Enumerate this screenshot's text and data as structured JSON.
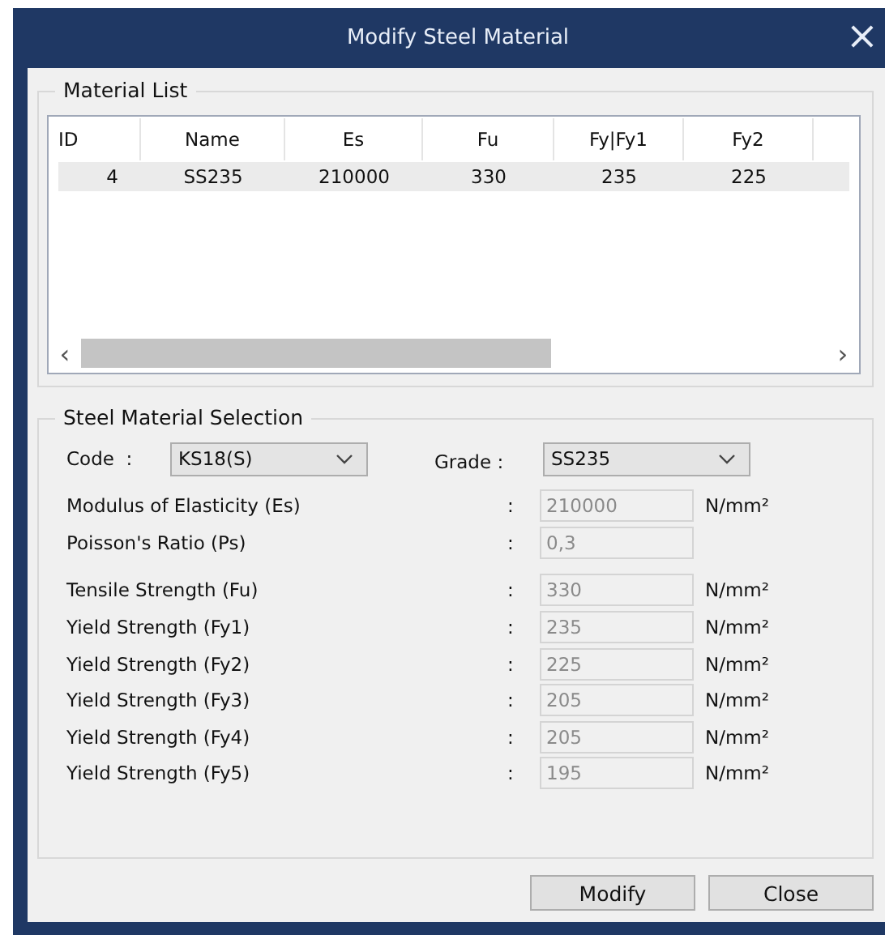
{
  "window": {
    "title": "Modify Steel Material",
    "close": "×"
  },
  "material_list": {
    "title": "Material List",
    "columns": [
      "ID",
      "Name",
      "Es",
      "Fu",
      "Fy|Fy1",
      "Fy2"
    ],
    "rows": [
      {
        "cells": [
          "4",
          "SS235",
          "210000",
          "330",
          "235",
          "225"
        ],
        "selected": true
      }
    ],
    "scroll_left": "‹",
    "scroll_right": "›"
  },
  "selection": {
    "title": "Steel Material Selection",
    "code": {
      "label": "Code  :",
      "value": "KS18(S)"
    },
    "grade": {
      "label": "Grade :",
      "value": "SS235"
    },
    "properties": [
      {
        "label": "Modulus of Elasticity (Es)",
        "colon": ":",
        "value": "210000",
        "unit": "N/mm²",
        "disabled": true
      },
      {
        "label": "Poisson's Ratio (Ps)",
        "colon": ":",
        "value": "0,3",
        "disabled": true
      },
      {
        "label": "Tensile Strength (Fu)",
        "colon": ":",
        "value": "330",
        "unit": "N/mm²",
        "disabled": true
      },
      {
        "label": "Yield Strength (Fy1)",
        "colon": ":",
        "value": "235",
        "unit": "N/mm²",
        "disabled": true
      },
      {
        "label": "Yield Strength (Fy2)",
        "colon": ":",
        "value": "225",
        "unit": "N/mm²",
        "disabled": true
      },
      {
        "label": "Yield Strength (Fy3)",
        "colon": ":",
        "value": "205",
        "unit": "N/mm²",
        "disabled": true
      },
      {
        "label": "Yield Strength (Fy4)",
        "colon": ":",
        "value": "205",
        "unit": "N/mm²",
        "disabled": true
      },
      {
        "label": "Yield Strength (Fy5)",
        "colon": ":",
        "value": "195",
        "unit": "N/mm²",
        "disabled": true
      }
    ]
  },
  "buttons": [
    "Modify",
    "Close"
  ]
}
